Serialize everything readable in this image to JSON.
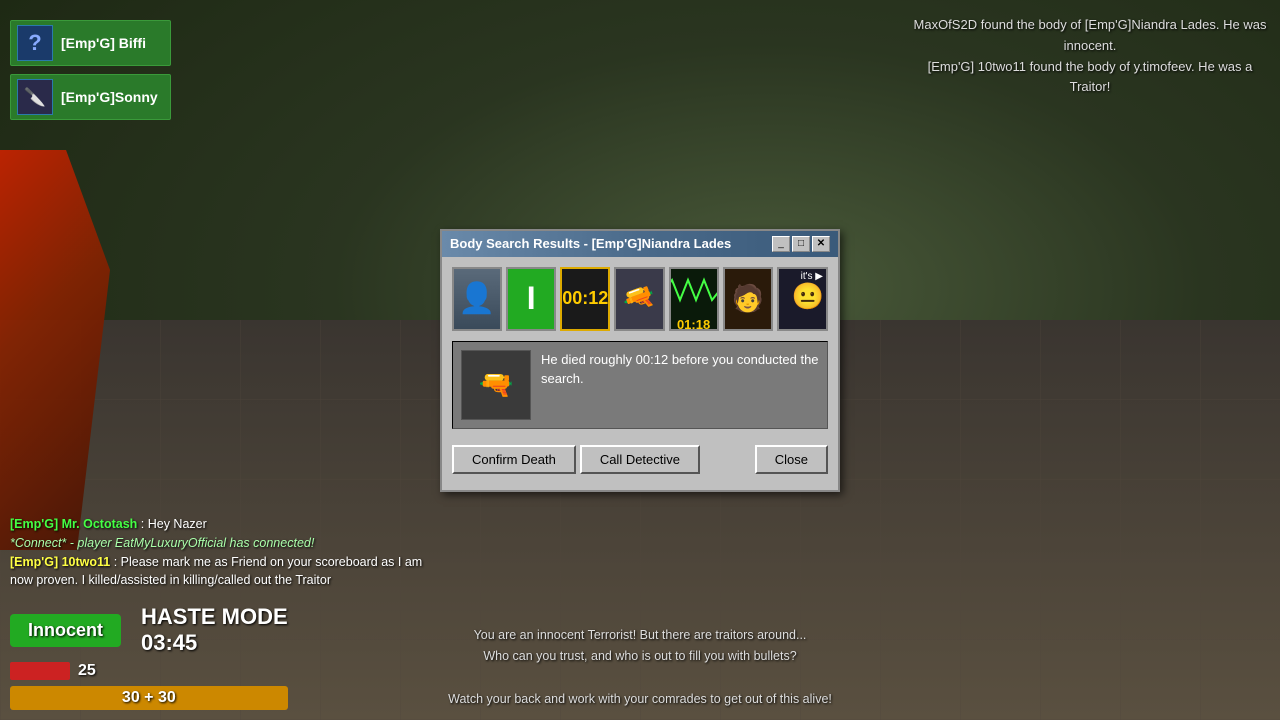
{
  "game": {
    "background_color": "#2a3a2a"
  },
  "player_list": {
    "items": [
      {
        "name": "[Emp'G] Biffi",
        "avatar_type": "question"
      },
      {
        "name": "[Emp'G]Sonny",
        "avatar_type": "knife"
      }
    ]
  },
  "kill_feed": {
    "lines": [
      "MaxOfS2D found the body of [Emp'G]Niandra Lades. He was innocent.",
      "[Emp'G] 10two11 found the body of y.timofeev. He was a Traitor!"
    ]
  },
  "chat": {
    "messages": [
      {
        "speaker": "[Emp'G] Mr. Octotash",
        "speaker_color": "green",
        "text": ": Hey Nazer"
      },
      {
        "type": "connect",
        "text": "*Connect* - player EatMyLuxuryOfficial has connected!"
      },
      {
        "speaker": "[Emp'G] 10two11",
        "speaker_color": "yellow",
        "text": ": Please mark me as Friend on your scoreboard as I am now proven. I killed/assisted in killing/called out the Traitor"
      }
    ]
  },
  "hud": {
    "role": "Innocent",
    "haste_label": "HASTE MODE",
    "timer": "03:45",
    "health_value": "25",
    "ammo": "30 + 30"
  },
  "bottom_message": {
    "line1": "You are an innocent Terrorist! But there are traitors around...",
    "line2": "Who can you trust, and who is out to fill you with bullets?",
    "line3": "Watch your back and work with your comrades to get out of this alive!"
  },
  "modal": {
    "title": "Body Search Results - [Emp'G]Niandra Lades",
    "controls": {
      "minimize": "_",
      "restore": "□",
      "close": "✕"
    },
    "icons": [
      {
        "type": "portrait",
        "label": "portrait"
      },
      {
        "type": "green_i",
        "label": "I"
      },
      {
        "type": "timer",
        "label": "00:12",
        "active": true
      },
      {
        "type": "rifle",
        "label": "rifle"
      },
      {
        "type": "wave",
        "label": "01:18"
      },
      {
        "type": "char",
        "label": "char"
      },
      {
        "type": "video",
        "label": "it's ▶"
      }
    ],
    "info_text": "He died roughly 00:12 before you conducted the search.",
    "buttons": {
      "confirm_death": "Confirm Death",
      "call_detective": "Call Detective",
      "close": "Close"
    }
  }
}
